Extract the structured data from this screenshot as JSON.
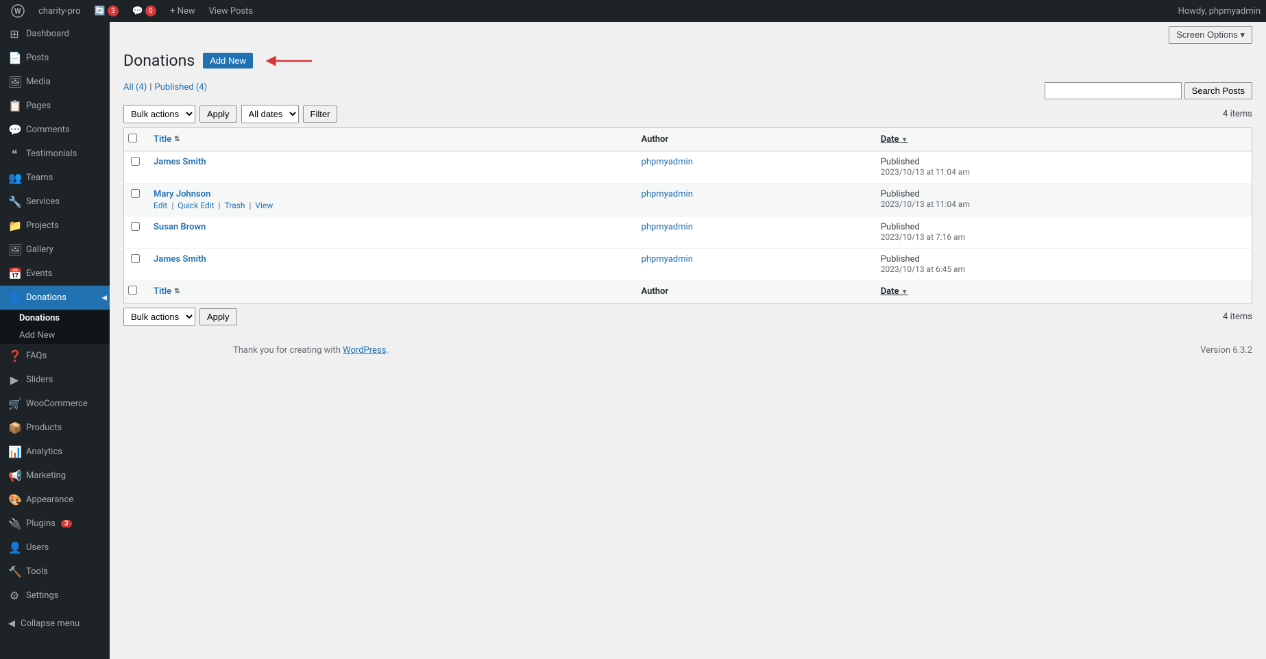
{
  "adminbar": {
    "site_name": "charity-pro",
    "comment_count": "3",
    "comment_icon_count": "0",
    "new_label": "+ New",
    "view_posts_label": "View Posts",
    "howdy": "Howdy, phpmyadmin"
  },
  "screen_options": {
    "label": "Screen Options ▾"
  },
  "sidebar": {
    "items": [
      {
        "id": "dashboard",
        "label": "Dashboard",
        "icon": "⊞"
      },
      {
        "id": "posts",
        "label": "Posts",
        "icon": "📄"
      },
      {
        "id": "media",
        "label": "Media",
        "icon": "🖼"
      },
      {
        "id": "pages",
        "label": "Pages",
        "icon": "📋"
      },
      {
        "id": "comments",
        "label": "Comments",
        "icon": "💬"
      },
      {
        "id": "testimonials",
        "label": "Testimonials",
        "icon": "❝"
      },
      {
        "id": "teams",
        "label": "Teams",
        "icon": "👥"
      },
      {
        "id": "services",
        "label": "Services",
        "icon": "🔧"
      },
      {
        "id": "projects",
        "label": "Projects",
        "icon": "📁"
      },
      {
        "id": "gallery",
        "label": "Gallery",
        "icon": "🖼"
      },
      {
        "id": "events",
        "label": "Events",
        "icon": "📅"
      },
      {
        "id": "donations",
        "label": "Donations",
        "icon": "👤",
        "active": true
      },
      {
        "id": "faqs",
        "label": "FAQs",
        "icon": "❓"
      },
      {
        "id": "sliders",
        "label": "Sliders",
        "icon": "▶"
      },
      {
        "id": "woocommerce",
        "label": "WooCommerce",
        "icon": "🛒"
      },
      {
        "id": "products",
        "label": "Products",
        "icon": "📦"
      },
      {
        "id": "analytics",
        "label": "Analytics",
        "icon": "📊"
      },
      {
        "id": "marketing",
        "label": "Marketing",
        "icon": "📢"
      },
      {
        "id": "appearance",
        "label": "Appearance",
        "icon": "🎨"
      },
      {
        "id": "plugins",
        "label": "Plugins",
        "icon": "🔌",
        "badge": "3"
      },
      {
        "id": "users",
        "label": "Users",
        "icon": "👤"
      },
      {
        "id": "tools",
        "label": "Tools",
        "icon": "🔨"
      },
      {
        "id": "settings",
        "label": "Settings",
        "icon": "⚙"
      }
    ],
    "submenu": {
      "parent": "donations",
      "items": [
        {
          "id": "donations-all",
          "label": "Donations",
          "active": true
        },
        {
          "id": "add-new",
          "label": "Add New"
        }
      ]
    },
    "collapse_label": "Collapse menu"
  },
  "page": {
    "title": "Donations",
    "add_new_label": "Add New",
    "total_items": "4 items",
    "filters": {
      "all_label": "All",
      "all_count": "(4)",
      "published_label": "Published",
      "published_count": "(4)",
      "sep": "|"
    },
    "search": {
      "placeholder": "",
      "button_label": "Search Posts"
    },
    "bulk_top": {
      "actions_label": "Bulk actions",
      "apply_label": "Apply",
      "dates_label": "All dates",
      "filter_label": "Filter"
    },
    "table": {
      "columns": [
        {
          "id": "title",
          "label": "Title",
          "sortable": true,
          "sorted": false
        },
        {
          "id": "author",
          "label": "Author",
          "sortable": false
        },
        {
          "id": "date",
          "label": "Date",
          "sortable": true,
          "sorted": true,
          "direction": "desc"
        }
      ],
      "rows": [
        {
          "id": 1,
          "title": "James Smith",
          "actions": [],
          "author": "phpmyadmin",
          "status": "Published",
          "date": "2023/10/13 at 11:04 am"
        },
        {
          "id": 2,
          "title": "Mary Johnson",
          "actions": [
            "Edit",
            "Quick Edit",
            "Trash",
            "View"
          ],
          "author": "phpmyadmin",
          "status": "Published",
          "date": "2023/10/13 at 11:04 am"
        },
        {
          "id": 3,
          "title": "Susan Brown",
          "actions": [],
          "author": "phpmyadmin",
          "status": "Published",
          "date": "2023/10/13 at 7:16 am"
        },
        {
          "id": 4,
          "title": "James Smith",
          "actions": [],
          "author": "phpmyadmin",
          "status": "Published",
          "date": "2023/10/13 at 6:45 am"
        }
      ]
    },
    "bulk_bottom": {
      "actions_label": "Bulk actions",
      "apply_label": "Apply",
      "total_items": "4 items"
    }
  },
  "footer": {
    "left": "Thank you for creating with WordPress",
    "right": "Version 6.3.2"
  }
}
